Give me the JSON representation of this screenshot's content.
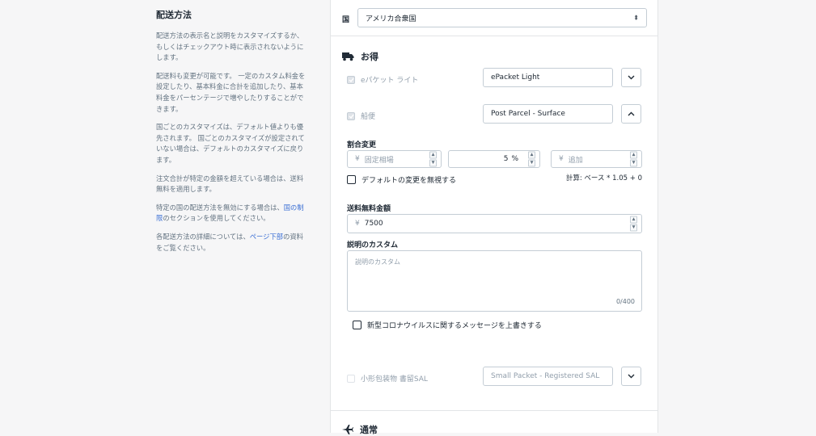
{
  "left": {
    "title": "配送方法",
    "p1": "配送方法の表示名と説明をカスタマイズするか、もしくはチェックアウト時に表示されないようにします。",
    "p2": "配送料も変更が可能です。 一定のカスタム料金を設定したり、基本料金に合計を追加したり、基本料金をパーセンテージで増やしたりすることができます。",
    "p3": "国ごとのカスタマイズは、デフォルト値よりも優先されます。 国ごとのカスタマイズが設定されていない場合は、デフォルトのカスタマイズに戻ります。",
    "p4": "注文合計が特定の金額を超えている場合は、送料無料を適用します。",
    "p5_before": "特定の国の配送方法を無効にする場合は、",
    "p5_link": "国の制限",
    "p5_after": "のセクションを使用してください。",
    "p6_before": "各配送方法の詳細については、",
    "p6_link": "ページ下部",
    "p6_after": "の資料をご覧ください。"
  },
  "country": {
    "label": "国",
    "value": "アメリカ合衆国"
  },
  "deal_section": {
    "title": "お得",
    "epacket": {
      "label": "eパケット ライト",
      "name": "ePacket Light"
    },
    "surface": {
      "label": "船便",
      "name": "Post Parcel - Surface"
    },
    "rate_change": {
      "label": "割合変更",
      "fixed_prefix": "¥",
      "fixed_placeholder": "固定相場",
      "percent_value": "5",
      "percent_suffix": "%",
      "add_prefix": "¥",
      "add_placeholder": "追加",
      "ignore_default_label": "デフォルトの変更を無視する",
      "calc_text": "計算: ベース * 1.05 + 0"
    },
    "free_shipping": {
      "label": "送料無料金額",
      "prefix": "¥",
      "value": "7500"
    },
    "custom_desc": {
      "label": "説明のカスタム",
      "placeholder": "説明のカスタム",
      "counter": "0/400"
    },
    "covid_label": "新型コロナウイルスに関するメッセージを上書きする",
    "small_packet": {
      "label": "小形包装物 書留SAL",
      "name": "Small Packet - Registered SAL"
    }
  },
  "normal_section": {
    "title": "通常"
  },
  "colors": {
    "link": "#3b6fd4",
    "text": "#212b36",
    "muted": "#637381",
    "border": "#c4cdd5"
  }
}
